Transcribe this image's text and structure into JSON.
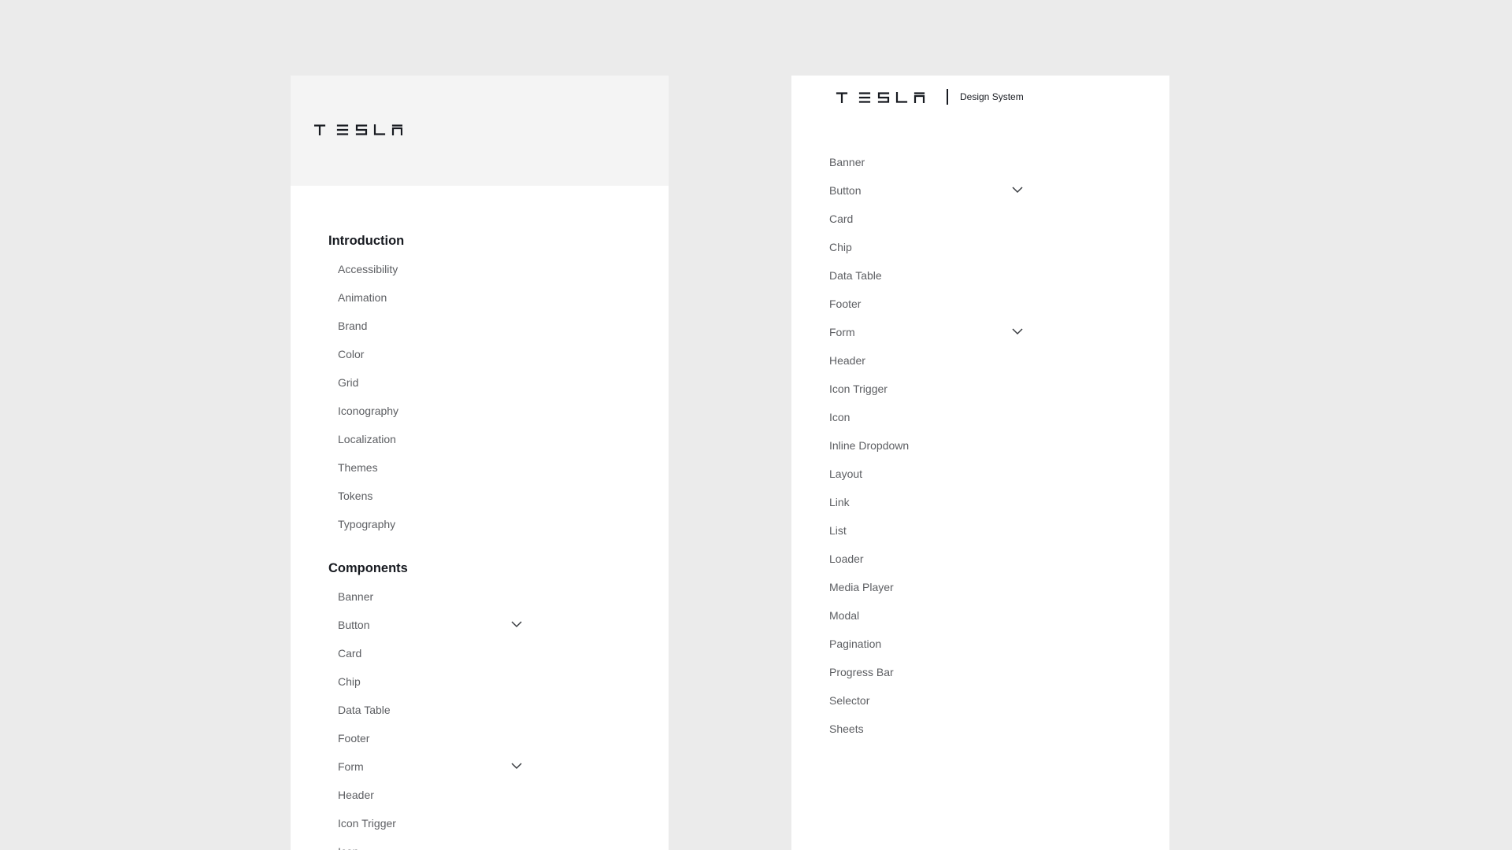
{
  "brand": {
    "logo_text": "TESLA",
    "logo_icon": "tesla-wordmark-icon",
    "design_system_label": "Design System"
  },
  "colors": {
    "page_background": "#ebebeb",
    "panel_background": "#ffffff",
    "header_background": "#f4f4f4",
    "heading_text": "#171a20",
    "item_text": "#5c5e62"
  },
  "left_panel": {
    "sections": [
      {
        "title": "Introduction",
        "items": [
          {
            "label": "Accessibility"
          },
          {
            "label": "Animation"
          },
          {
            "label": "Brand"
          },
          {
            "label": "Color"
          },
          {
            "label": "Grid"
          },
          {
            "label": "Iconography"
          },
          {
            "label": "Localization"
          },
          {
            "label": "Themes"
          },
          {
            "label": "Tokens"
          },
          {
            "label": "Typography"
          }
        ]
      },
      {
        "title": "Components",
        "items": [
          {
            "label": "Banner"
          },
          {
            "label": "Button",
            "expandable": true,
            "icon": "chevron-down-icon"
          },
          {
            "label": "Card"
          },
          {
            "label": "Chip"
          },
          {
            "label": "Data Table"
          },
          {
            "label": "Footer"
          },
          {
            "label": "Form",
            "expandable": true,
            "icon": "chevron-down-icon"
          },
          {
            "label": "Header"
          },
          {
            "label": "Icon Trigger"
          },
          {
            "label": "Icon"
          }
        ]
      }
    ]
  },
  "right_panel": {
    "items": [
      {
        "label": "Banner"
      },
      {
        "label": "Button",
        "expandable": true,
        "icon": "chevron-down-icon"
      },
      {
        "label": "Card"
      },
      {
        "label": "Chip"
      },
      {
        "label": "Data Table"
      },
      {
        "label": "Footer"
      },
      {
        "label": "Form",
        "expandable": true,
        "icon": "chevron-down-icon"
      },
      {
        "label": "Header"
      },
      {
        "label": "Icon Trigger"
      },
      {
        "label": "Icon"
      },
      {
        "label": "Inline Dropdown"
      },
      {
        "label": "Layout"
      },
      {
        "label": "Link"
      },
      {
        "label": "List"
      },
      {
        "label": "Loader"
      },
      {
        "label": "Media Player"
      },
      {
        "label": "Modal"
      },
      {
        "label": "Pagination"
      },
      {
        "label": "Progress Bar"
      },
      {
        "label": "Selector"
      },
      {
        "label": "Sheets"
      }
    ]
  }
}
